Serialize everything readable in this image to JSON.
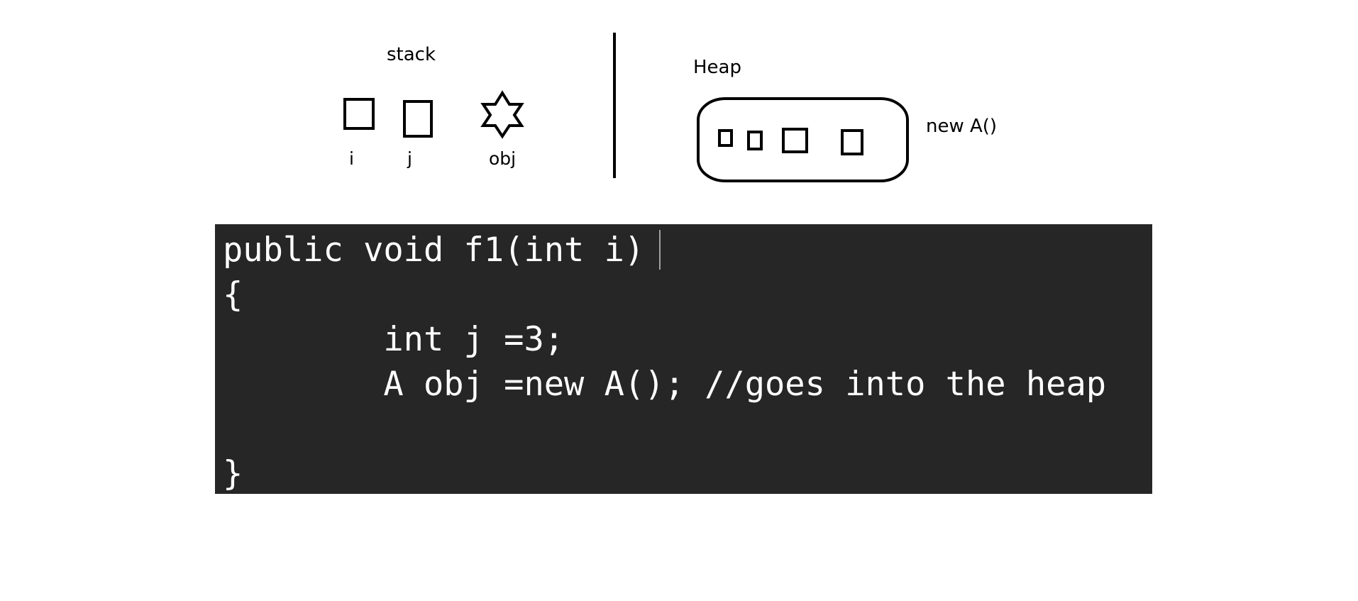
{
  "stack": {
    "title": "stack",
    "variables": [
      {
        "label": "i",
        "icon": "square"
      },
      {
        "label": "j",
        "icon": "tall-rectangle"
      },
      {
        "label": "obj",
        "icon": "six-pointed-star"
      }
    ]
  },
  "heap": {
    "title": "Heap",
    "object_label": "new A()",
    "field_count": 4
  },
  "code": {
    "lines": [
      "public void f1(int i)",
      "{",
      "        int j =3;",
      "        A obj =new A(); //goes into the heap",
      "",
      "}"
    ]
  },
  "colors": {
    "code_background": "#262626",
    "code_text": "#ffffff",
    "stroke": "#000000"
  }
}
